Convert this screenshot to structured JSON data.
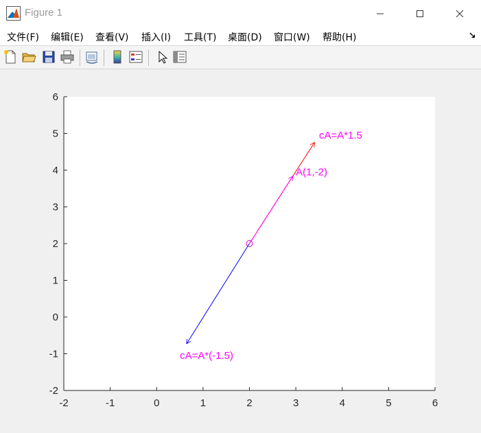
{
  "window": {
    "title": "Figure 1",
    "controls": [
      "minimize",
      "maximize",
      "close"
    ]
  },
  "menu": {
    "items": [
      {
        "label": "文件(F)"
      },
      {
        "label": "编辑(E)"
      },
      {
        "label": "查看(V)"
      },
      {
        "label": "插入(I)"
      },
      {
        "label": "工具(T)"
      },
      {
        "label": "桌面(D)"
      },
      {
        "label": "窗口(W)"
      },
      {
        "label": "帮助(H)"
      }
    ]
  },
  "toolbar": {
    "buttons": [
      {
        "icon": "new-figure-icon"
      },
      {
        "icon": "open-file-icon"
      },
      {
        "icon": "save-icon"
      },
      {
        "icon": "print-icon"
      },
      {
        "icon": "link-plot-icon"
      },
      {
        "icon": "colorbar-icon"
      },
      {
        "icon": "legend-icon"
      },
      {
        "icon": "pointer-icon"
      },
      {
        "icon": "property-editor-icon"
      }
    ]
  },
  "chart_data": {
    "type": "line",
    "xlim": [
      -2,
      6
    ],
    "ylim": [
      -2,
      6
    ],
    "xticks": [
      "-2",
      "-1",
      "0",
      "1",
      "2",
      "3",
      "4",
      "5",
      "6"
    ],
    "yticks": [
      "-2",
      "-1",
      "0",
      "1",
      "2",
      "3",
      "4",
      "5",
      "6"
    ],
    "grid": false,
    "origin_marker": {
      "x": 2,
      "y": 2,
      "marker": "circle",
      "color": "#cc00cc"
    },
    "vectors": [
      {
        "x0": 2,
        "y0": 2,
        "x1": 3.4,
        "y1": 4.75,
        "color": "#ff0000"
      },
      {
        "x0": 2,
        "y0": 2,
        "x1": 2.93,
        "y1": 3.83,
        "color": "#ff00ff"
      },
      {
        "x0": 2,
        "y0": 2,
        "x1": 0.65,
        "y1": -0.72,
        "color": "#0000ff"
      }
    ],
    "annotations": [
      {
        "text": "cA=A*1.5",
        "x": 3.5,
        "y": 4.95,
        "color": "#ff00ff"
      },
      {
        "text": "A(1,-2)",
        "x": 3.0,
        "y": 3.95,
        "color": "#ff00ff"
      },
      {
        "text": "cA=A*(-1.5)",
        "x": 0.5,
        "y": -1.05,
        "color": "#ff00ff"
      }
    ]
  }
}
